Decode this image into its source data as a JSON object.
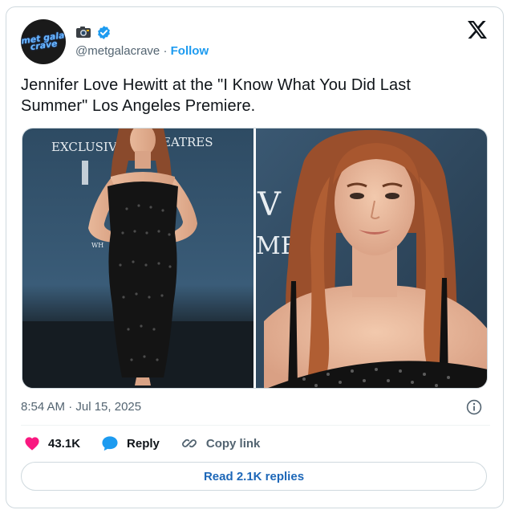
{
  "author": {
    "avatar_text": "met gala crave",
    "handle": "@metgalacrave",
    "separator": " · ",
    "follow_label": "Follow"
  },
  "tweet": {
    "text": "Jennifer Love Hewitt at the \"I Know What You Did Last Summer\" Los Angeles Premiere.",
    "timestamp": "8:54 AM · Jul 15, 2025"
  },
  "media": {
    "left_backdrop_line1_a": "EXCLUSIVE",
    "left_backdrop_line1_b": "EATRES",
    "left_backdrop_small": "WH",
    "right_backdrop_a": "V",
    "right_backdrop_b": "MER"
  },
  "actions": {
    "like_count": "43.1K",
    "reply_label": "Reply",
    "copy_link_label": "Copy link"
  },
  "read_replies_label": "Read 2.1K replies",
  "colors": {
    "accent": "#1d9bf0",
    "like": "#f91880",
    "text_secondary": "#536471"
  },
  "icons": [
    "camera-emoji-icon",
    "verified-badge-icon",
    "x-logo-icon",
    "info-icon",
    "heart-icon",
    "reply-bubble-icon",
    "link-icon"
  ]
}
